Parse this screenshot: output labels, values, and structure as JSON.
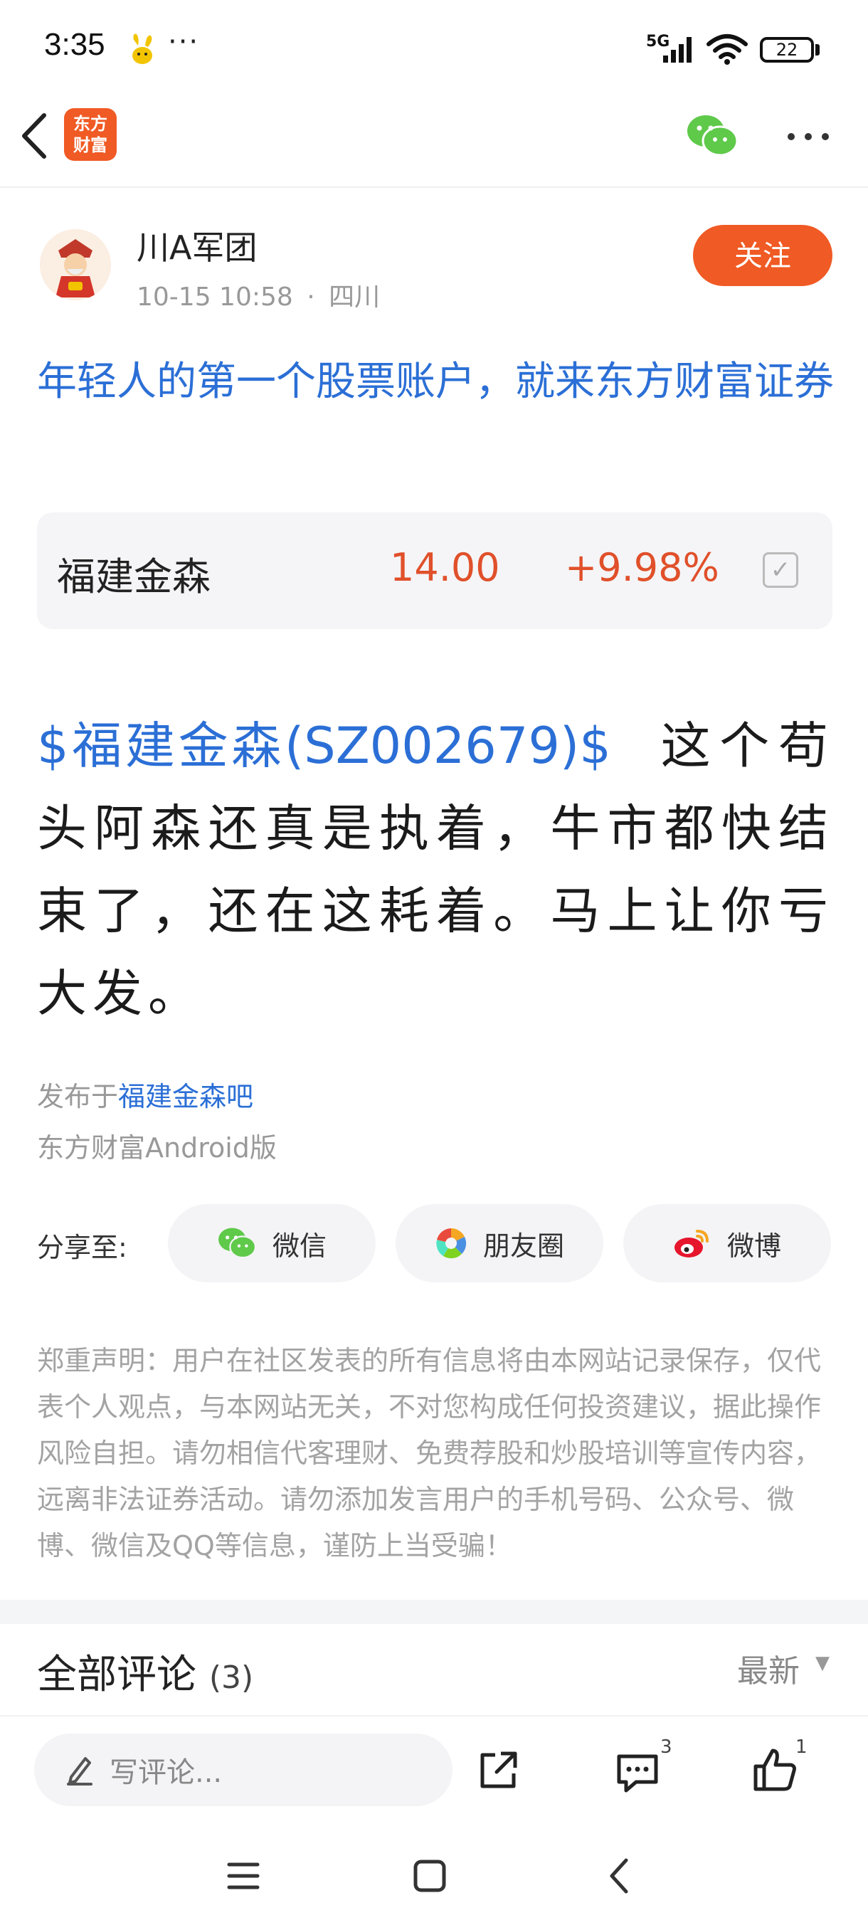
{
  "status_bar": {
    "time": "3:35",
    "more": "···",
    "network": "5G",
    "battery": "22"
  },
  "author": {
    "name": "川A军团",
    "date": "10-15 10:58",
    "separator": "·",
    "location": "四川",
    "follow_label": "关注"
  },
  "post": {
    "title": "年轻人的第一个股票账户，就来东方财富证券",
    "stock_link": "$福建金森(SZ002679)$",
    "body": "这个苟头阿森还真是执着，牛市都快结束了，还在这耗着。马上让你亏大发。",
    "publish_prefix": "发布于",
    "bar_name": "福建金森吧",
    "source": "东方财富Android版"
  },
  "stock_card": {
    "name": "福建金森",
    "price": "14.00",
    "change": "+9.98%"
  },
  "app": {
    "logo_line1": "东方",
    "logo_line2": "财富"
  },
  "share": {
    "label": "分享至:",
    "wechat": "微信",
    "moments": "朋友圈",
    "weibo": "微博"
  },
  "disclaimer": "郑重声明：用户在社区发表的所有信息将由本网站记录保存，仅代表个人观点，与本网站无关，不对您构成任何投资建议，据此操作风险自担。请勿相信代客理财、免费荐股和炒股培训等宣传内容，远离非法证券活动。请勿添加发言用户的手机号码、公众号、微博、微信及QQ等信息，谨防上当受骗！",
  "comments": {
    "title": "全部评论",
    "count": "(3)",
    "sort": "最新"
  },
  "bottom_bar": {
    "input_placeholder": "写评论...",
    "comment_badge": "3",
    "like_badge": "1"
  },
  "colors": {
    "brand": "#f05a24",
    "link": "#2b6fd6",
    "price_up": "#e0502a"
  },
  "icons": [
    "back-icon",
    "wechat-icon",
    "more-icon",
    "edit-icon",
    "share-out-icon",
    "comment-icon",
    "like-icon",
    "moments-icon",
    "weibo-icon",
    "menu-nav-icon",
    "home-nav-icon",
    "back-nav-icon"
  ]
}
